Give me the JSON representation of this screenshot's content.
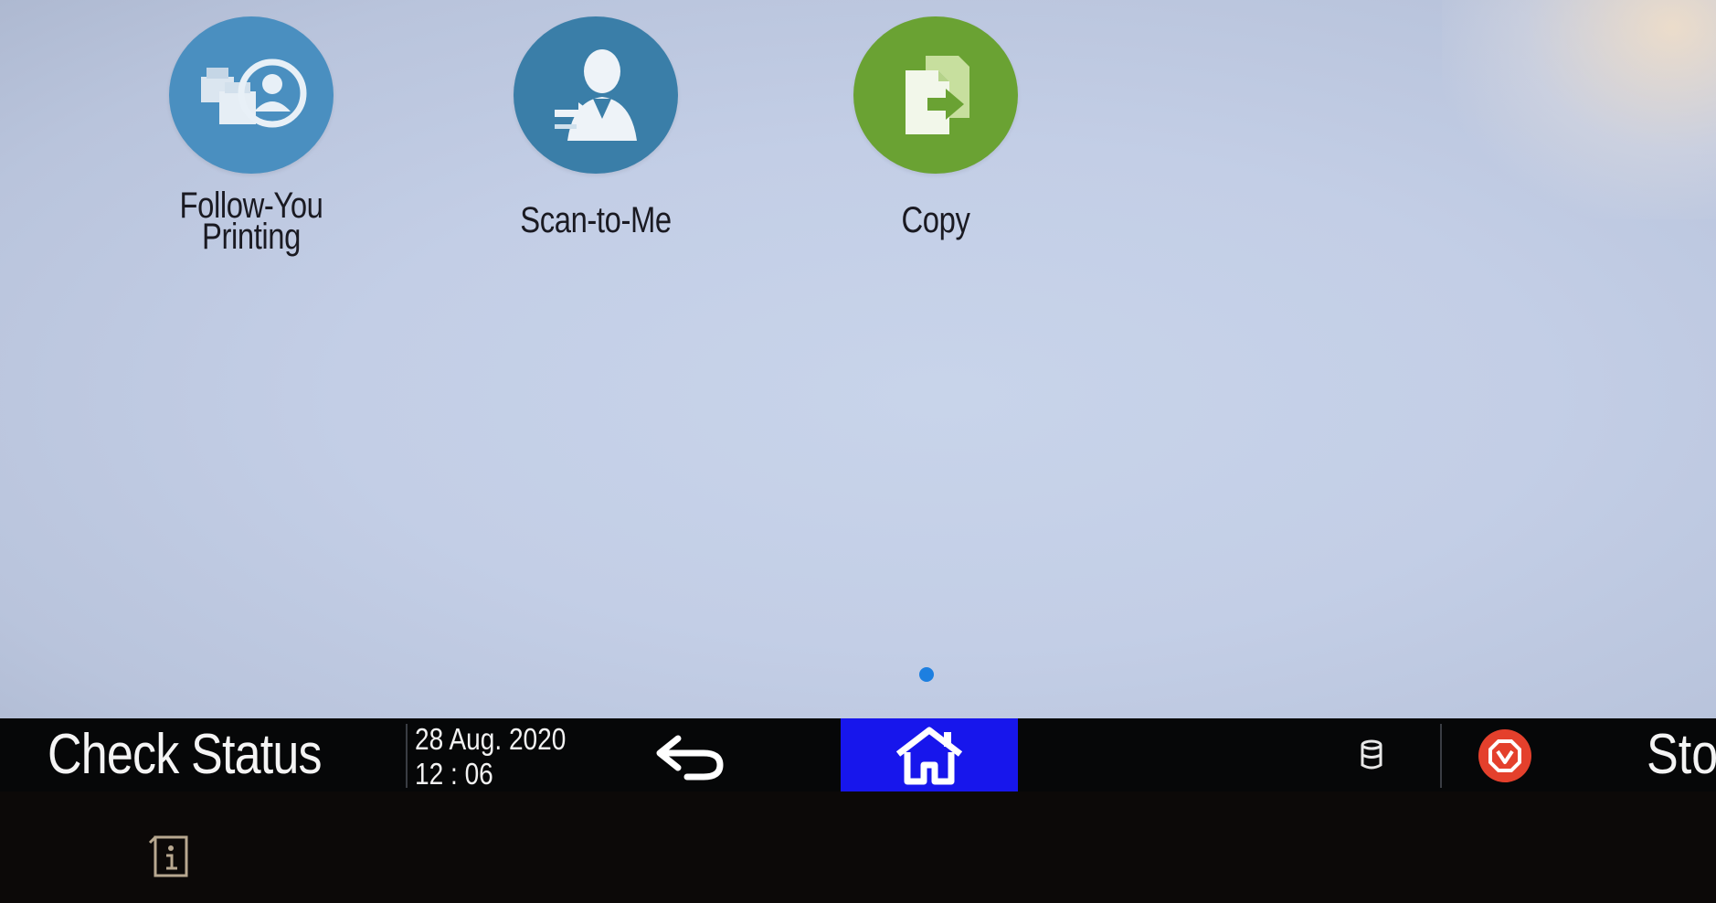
{
  "apps": [
    {
      "label_line1": "Follow-You",
      "label_line2": "Printing",
      "icon": "follow-you-printing-icon",
      "color": "#4a8fc0"
    },
    {
      "label_line1": "Scan-to-Me",
      "label_line2": "",
      "icon": "scan-to-me-icon",
      "color": "#3a7ea8"
    },
    {
      "label_line1": "Copy",
      "label_line2": "",
      "icon": "copy-icon",
      "color": "#6aa233"
    }
  ],
  "taskbar": {
    "check_status": "Check Status",
    "date": "28 Aug. 2020",
    "time": "12 : 06",
    "stop_label": "Sto",
    "home_color": "#1716ec",
    "stop_color": "#e4402c"
  },
  "page_indicator": {
    "current": 1,
    "total": 1,
    "color": "#1d7fe0"
  }
}
